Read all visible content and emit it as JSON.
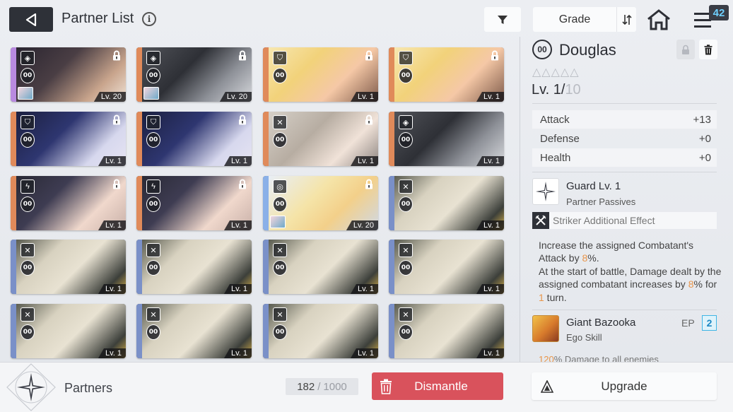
{
  "header": {
    "title": "Partner List",
    "info_glyph": "i",
    "sort_label": "Grade",
    "notification_count": "42"
  },
  "partners": [
    {
      "level": "Lv. 20",
      "tier": "00",
      "role": "defender",
      "locked": true,
      "theme": "dark-hair",
      "stripe": "#b98ae0",
      "has_sub": true
    },
    {
      "level": "Lv. 20",
      "tier": "00",
      "role": "defender",
      "locked": true,
      "theme": "mech",
      "stripe": "#e08a5a",
      "has_sub": true
    },
    {
      "level": "Lv. 1",
      "tier": "00",
      "role": "guard",
      "locked": true,
      "theme": "blonde",
      "stripe": "#e08a5a",
      "has_sub": false
    },
    {
      "level": "Lv. 1",
      "tier": "00",
      "role": "guard",
      "locked": true,
      "theme": "blonde",
      "stripe": "#e08a5a",
      "has_sub": false
    },
    {
      "level": "Lv. 1",
      "tier": "00",
      "role": "guard",
      "locked": true,
      "theme": "navy-hair",
      "stripe": "#e08a5a",
      "has_sub": false
    },
    {
      "level": "Lv. 1",
      "tier": "00",
      "role": "guard",
      "locked": true,
      "theme": "navy-hair",
      "stripe": "#e08a5a",
      "has_sub": false
    },
    {
      "level": "Lv. 1",
      "tier": "00",
      "role": "striker",
      "locked": true,
      "theme": "silver-hair",
      "stripe": "#e08a5a",
      "has_sub": false
    },
    {
      "level": "Lv. 1",
      "tier": "00",
      "role": "defender",
      "locked": false,
      "theme": "mech",
      "stripe": "#e08a5a",
      "has_sub": false
    },
    {
      "level": "Lv. 1",
      "tier": "00",
      "role": "ranger",
      "locked": true,
      "theme": "glasses",
      "stripe": "#e08a5a",
      "has_sub": false
    },
    {
      "level": "Lv. 1",
      "tier": "00",
      "role": "ranger",
      "locked": true,
      "theme": "glasses",
      "stripe": "#e08a5a",
      "has_sub": false
    },
    {
      "level": "Lv. 20",
      "tier": "00",
      "role": "caster",
      "locked": true,
      "theme": "blonde-light",
      "stripe": "#8ab0e8",
      "has_sub": true
    },
    {
      "level": "Lv. 1",
      "tier": "00",
      "role": "striker",
      "locked": false,
      "theme": "douglas",
      "stripe": "#7a90c8",
      "has_sub": false
    },
    {
      "level": "Lv. 1",
      "tier": "00",
      "role": "striker",
      "locked": false,
      "theme": "douglas",
      "stripe": "#7a90c8",
      "has_sub": false
    },
    {
      "level": "Lv. 1",
      "tier": "00",
      "role": "striker",
      "locked": false,
      "theme": "douglas",
      "stripe": "#7a90c8",
      "has_sub": false
    },
    {
      "level": "Lv. 1",
      "tier": "00",
      "role": "striker",
      "locked": false,
      "theme": "douglas",
      "stripe": "#7a90c8",
      "has_sub": false
    },
    {
      "level": "Lv. 1",
      "tier": "00",
      "role": "striker",
      "locked": false,
      "theme": "douglas",
      "stripe": "#7a90c8",
      "has_sub": false
    },
    {
      "level": "Lv. 1",
      "tier": "00",
      "role": "striker",
      "locked": false,
      "theme": "douglas",
      "stripe": "#7a90c8",
      "has_sub": false
    },
    {
      "level": "Lv. 1",
      "tier": "00",
      "role": "striker",
      "locked": false,
      "theme": "douglas",
      "stripe": "#7a90c8",
      "has_sub": false
    },
    {
      "level": "Lv. 1",
      "tier": "00",
      "role": "striker",
      "locked": false,
      "theme": "douglas",
      "stripe": "#7a90c8",
      "has_sub": false
    },
    {
      "level": "Lv. 1",
      "tier": "00",
      "role": "striker",
      "locked": false,
      "theme": "douglas",
      "stripe": "#7a90c8",
      "has_sub": false
    }
  ],
  "detail": {
    "tier": "00",
    "name": "Douglas",
    "stars": "△△△△△",
    "level_current": "Lv. 1/",
    "level_max": "10",
    "stats": [
      {
        "label": "Attack",
        "value": "+13"
      },
      {
        "label": "Defense",
        "value": "+0"
      },
      {
        "label": "Health",
        "value": "+0"
      }
    ],
    "passive": {
      "name": "Guard Lv. 1",
      "type": "Partner Passives"
    },
    "striker_effect": "Striker Additional Effect",
    "description": {
      "p1": "Increase the assigned Combatant's Attack by ",
      "p1_val": "8",
      "p1_end": "%.",
      "p2": "At the start of battle, Damage dealt by the assigned combatant increases by ",
      "p2_val": "8",
      "p2_mid": "% for ",
      "p2_turns": "1",
      "p2_end": " turn."
    },
    "ego_skill": {
      "name": "Giant Bazooka",
      "type": "Ego Skill",
      "ep_label": "EP",
      "ep_value": "2"
    },
    "ego_desc_value": "120",
    "ego_desc_text": "% Damage to all enemies"
  },
  "footer": {
    "section_label": "Partners",
    "count_current": "182",
    "count_sep": "/",
    "count_max": "1000",
    "dismantle_label": "Dismantle",
    "upgrade_label": "Upgrade"
  },
  "colors": {
    "accent_red": "#d9525c",
    "ep_blue": "#40b5e5",
    "highlight_orange": "#e8954a",
    "dark_button": "#2e3138"
  }
}
